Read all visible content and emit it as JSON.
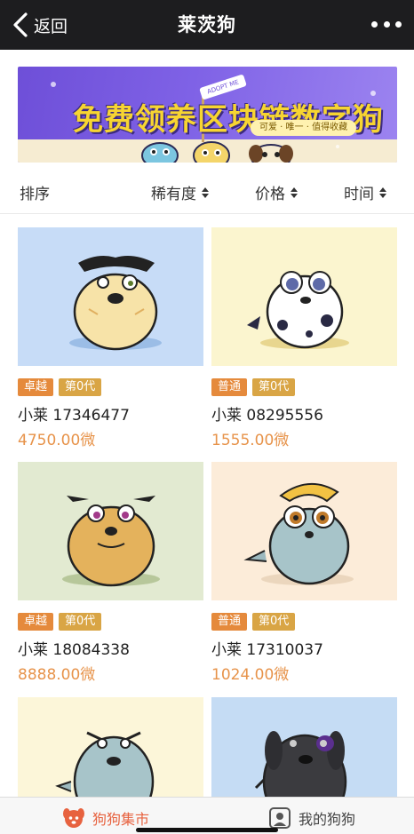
{
  "nav": {
    "back_label": "返回",
    "title": "莱茨狗"
  },
  "banner": {
    "title": "免费领养区块链数字狗",
    "adopt_tag": "ADOPT ME",
    "tags": "可爱 · 唯一 · 值得收藏"
  },
  "sort": {
    "label": "排序",
    "options": [
      "稀有度",
      "价格",
      "时间"
    ]
  },
  "cards": [
    {
      "rarity": "卓越",
      "generation": "第0代",
      "name": "小莱 17346477",
      "price": "4750.00微",
      "bg": "#c7dcf7"
    },
    {
      "rarity": "普通",
      "generation": "第0代",
      "name": "小莱 08295556",
      "price": "1555.00微",
      "bg": "#fbf5cf"
    },
    {
      "rarity": "卓越",
      "generation": "第0代",
      "name": "小莱 18084338",
      "price": "8888.00微",
      "bg": "#e2ead1"
    },
    {
      "rarity": "普通",
      "generation": "第0代",
      "name": "小莱 17310037",
      "price": "1024.00微",
      "bg": "#fcecd9"
    },
    {
      "bg": "#fcf6d9"
    },
    {
      "bg": "#c5dcf4"
    }
  ],
  "tabbar": {
    "market": "狗狗集市",
    "mine": "我的狗狗"
  },
  "colors": {
    "nav_bg": "#1d1d1f",
    "accent": "#e7623f",
    "price": "#e7934a",
    "badge_rare": "#e58a3c",
    "badge_gen": "#d9a545"
  }
}
